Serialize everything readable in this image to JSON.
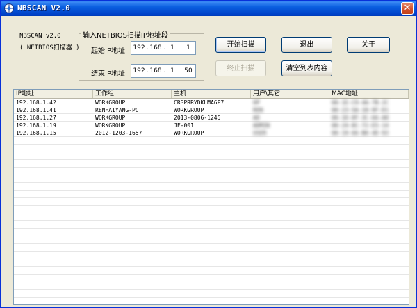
{
  "window": {
    "title": "NBSCAN V2.0",
    "close_label": "✕"
  },
  "app": {
    "name_line1": "NBSCAN v2.0",
    "name_line2": "( NETBIOS扫描器 )"
  },
  "ip_group": {
    "title": "输入NETBIOS扫描IP地址段",
    "start_label": "起始IP地址",
    "start_ip": [
      "192",
      "168",
      "1",
      "1"
    ],
    "end_label": "结束IP地址",
    "end_ip": [
      "192",
      "168",
      "1",
      "50"
    ]
  },
  "buttons": {
    "start_scan": "开始扫描",
    "stop_scan": "终止扫描",
    "exit": "退出",
    "about": "关于",
    "clear_list": "清空列表内容"
  },
  "table": {
    "columns": [
      "IP地址",
      "工作组",
      "主机",
      "用户\\其它",
      "MAC地址"
    ],
    "rows": [
      {
        "ip": "192.168.1.42",
        "group": "WORKGROUP",
        "host": "CRSPRRYDKLMA6P7",
        "user": "HP",
        "mac": "00-1E-C9-4A-7B-2C"
      },
      {
        "ip": "192.168.1.41",
        "group": "RENHAIYANG-PC",
        "host": "WORKGROUP",
        "user": "REN",
        "mac": "00-23-5A-18-9F-D1"
      },
      {
        "ip": "192.168.1.27",
        "group": "WORKGROUP",
        "host": "2013-0806-1245",
        "user": "AD",
        "mac": "00-1D-0F-3C-66-A8"
      },
      {
        "ip": "192.168.1.19",
        "group": "WORKGROUP",
        "host": "JF-001",
        "user": "ADMIN",
        "mac": "00-24-8C-72-E5-14"
      },
      {
        "ip": "192.168.1.15",
        "group": "2012-1203-1657",
        "host": "WORKGROUP",
        "user": "USER",
        "mac": "00-19-66-B0-4D-93"
      }
    ]
  }
}
